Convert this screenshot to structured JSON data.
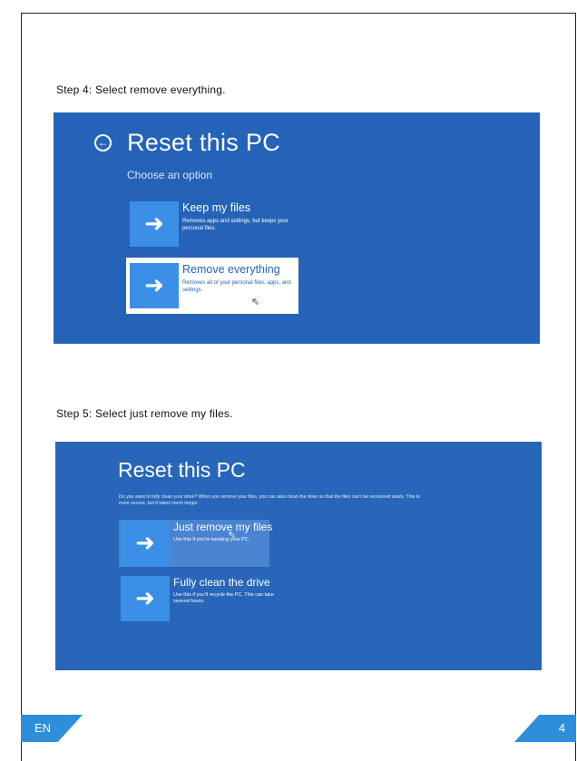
{
  "step4": {
    "label": "Step 4: Select remove everything.",
    "screen": {
      "title": "Reset this PC",
      "subtitle": "Choose an option",
      "options": [
        {
          "title": "Keep my files",
          "description": "Removes apps and settings, but keeps your personal files."
        },
        {
          "title": "Remove everything",
          "description": "Removes all of your personal files, apps, and settings."
        }
      ]
    }
  },
  "step5": {
    "label": "Step 5: Select just remove my files.",
    "screen": {
      "title": "Reset this PC",
      "description": "Do you want to fully clean your drive? When you remove your files, you can also clean the drive so that the files can't be recovered easily. This is more secure, but it takes much longer.",
      "options": [
        {
          "title": "Just remove my files",
          "description": "Use this if you're keeping your PC."
        },
        {
          "title": "Fully clean the drive",
          "description": "Use this if you'll recycle the PC. This can take several hours."
        }
      ]
    }
  },
  "footer": {
    "language": "EN",
    "page_number": "4"
  },
  "colors": {
    "screen_blue": "#2563b8",
    "tile_blue": "#3b8fe6",
    "tag_blue": "#2f8ed9"
  },
  "icons": [
    "back-arrow-icon",
    "right-arrow-icon",
    "mouse-cursor-icon"
  ]
}
